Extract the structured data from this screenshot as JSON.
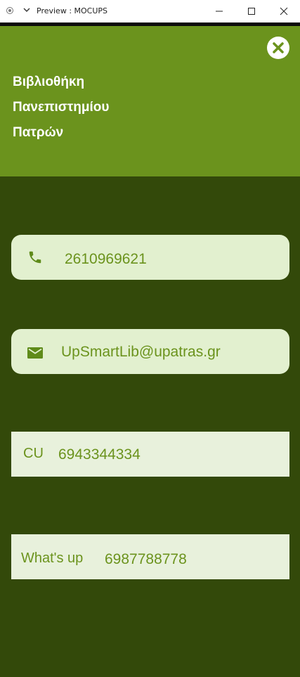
{
  "window": {
    "title": "Preview : MOCUPS"
  },
  "header": {
    "name_lines": [
      "Βιβλιοθήκη",
      "Πανεπιστημίου",
      "Πατρών"
    ]
  },
  "contacts": {
    "phone": {
      "icon": "phone-icon",
      "value": "2610969621"
    },
    "email": {
      "icon": "mail-icon",
      "value": "UpSmartLib@upatras.gr"
    },
    "cu": {
      "label": "CU",
      "value": "6943344334"
    },
    "whatsup": {
      "label": "What's up",
      "value": "6987788778"
    }
  },
  "colors": {
    "header_bg": "#6b931d",
    "main_bg": "#33490a",
    "pill_bg": "#e2f0cf",
    "accent_text": "#6b931d"
  }
}
